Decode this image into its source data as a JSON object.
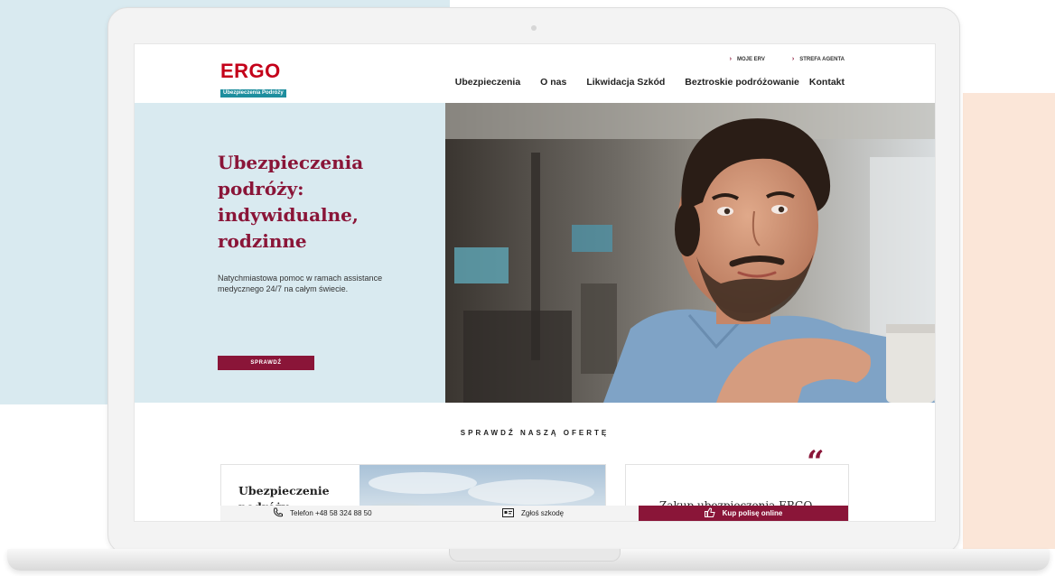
{
  "colors": {
    "brand_red": "#c4001a",
    "accent": "#8a1538",
    "teal": "#1e8e9e",
    "hero_bg": "#d9eaf0",
    "side_peach": "#fbe6d8"
  },
  "header": {
    "logo": {
      "text": "ERGO",
      "tagline": "Ubezpieczenia Podróży"
    },
    "top_links": [
      {
        "label": "MOJE ERV",
        "icon": "chevron-right-icon"
      },
      {
        "label": "STREFA AGENTA",
        "icon": "chevron-right-icon"
      }
    ],
    "nav": [
      {
        "label": "Ubezpieczenia"
      },
      {
        "label": "O nas"
      },
      {
        "label": "Likwidacja Szkód"
      },
      {
        "label": "Beztroskie podróżowanie"
      },
      {
        "label": "Kontakt"
      }
    ]
  },
  "hero": {
    "title": "Ubezpieczenia podróży: indywidualne, rodzinne",
    "subtitle": "Natychmiastowa pomoc w ramach assistance medycznego 24/7 na całym świecie.",
    "button": "SPRAWDŹ"
  },
  "offer": {
    "heading": "SPRAWDŹ NASZĄ OFERTĘ",
    "card1_title": "Ubezpieczenie podróży",
    "card2_text": "Zakup ubezpieczenia ERGO"
  },
  "bottom_bar": {
    "phone": {
      "label": "Telefon +48 58 324 88 50",
      "icon": "phone-icon"
    },
    "claim": {
      "label": "Zgłoś szkodę",
      "icon": "id-card-icon"
    },
    "buy": {
      "label": "Kup polisę online",
      "icon": "thumbs-up-icon"
    }
  }
}
